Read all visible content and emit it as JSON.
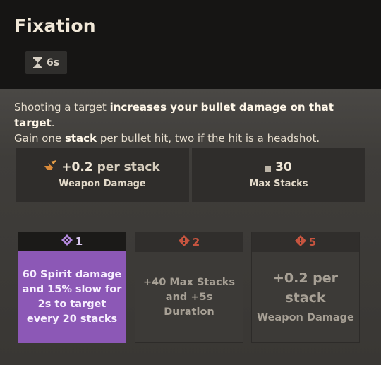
{
  "ability": {
    "title": "Fixation",
    "cooldown": "6s"
  },
  "description": {
    "p1": "Shooting a target ",
    "p1_bold": "increases your bullet damage on that target",
    "p1_end": ".",
    "p2": "Gain one ",
    "p2_bold": "stack",
    "p2_end": " per bullet hit, two if the hit is a headshot."
  },
  "stats": [
    {
      "value": "+0.2",
      "unit": "per stack",
      "label": "Weapon Damage",
      "icon": "weapon-damage-icon"
    },
    {
      "value": "30",
      "unit": "",
      "label": "Max Stacks",
      "icon": "square-bullet-icon"
    }
  ],
  "tiers": [
    {
      "number": "1",
      "text": "60 Spirit damage and 15% slow for 2s to target every 20 stacks",
      "state": "active"
    },
    {
      "number": "2",
      "text": "+40 Max Stacks and +5s Duration",
      "state": "locked"
    },
    {
      "number": "5",
      "line1": "+0.2 per",
      "line2": "stack",
      "line3": "Weapon Damage",
      "state": "locked"
    }
  ],
  "colors": {
    "active_tier": "#8c58b6",
    "locked_tier_number": "#c6543f",
    "header_bg": "#161514"
  }
}
